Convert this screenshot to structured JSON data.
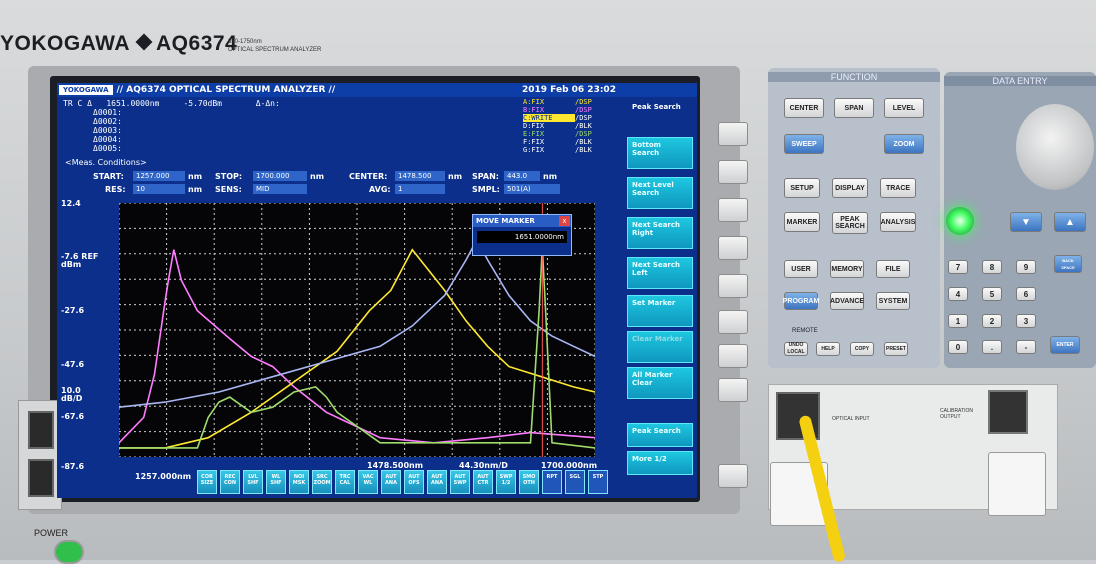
{
  "device": {
    "brand": "YOKOGAWA",
    "model": "AQ6374",
    "range": "350-1750nm",
    "product": "OPTICAL SPECTRUM ANALYZER",
    "power_label": "POWER"
  },
  "screen": {
    "logo": "YOKOGAWA",
    "title": "// AQ6374 OPTICAL SPECTRUM ANALYZER //",
    "datetime": "2019 Feb 06 23:02",
    "marker": {
      "trace_label": "TR C Δ",
      "wavelength": "1651.0000nm",
      "level": "-5.70dBm",
      "delta_label": "Δ-Δn:",
      "deltas": [
        "Δ0001:",
        "Δ0002:",
        "Δ0003:",
        "Δ0004:",
        "Δ0005:"
      ]
    },
    "traces": [
      {
        "name": "A:FIX",
        "mode": "/DSP",
        "color": "#ffe830"
      },
      {
        "name": "B:FIX",
        "mode": "/DSP",
        "color": "#ff7cff"
      },
      {
        "name": "C:WRITE",
        "mode": "/DSP",
        "color": "#ffffff"
      },
      {
        "name": "D:FIX",
        "mode": "/BLK",
        "color": "#ffffff"
      },
      {
        "name": "E:FIX",
        "mode": "/DSP",
        "color": "#9fdc6b"
      },
      {
        "name": "F:FIX",
        "mode": "/BLK",
        "color": "#ffffff"
      },
      {
        "name": "G:FIX",
        "mode": "/BLK",
        "color": "#ffffff"
      }
    ],
    "meas": {
      "title": "<Meas. Conditions>",
      "start_label": "START:",
      "start": "1257.000",
      "start_unit": "nm",
      "stop_label": "STOP:",
      "stop": "1700.000",
      "stop_unit": "nm",
      "center_label": "CENTER:",
      "center": "1478.500",
      "center_unit": "nm",
      "span_label": "SPAN:",
      "span": "443.0",
      "span_unit": "nm",
      "res_label": "RES:",
      "res": "10",
      "res_unit": "nm",
      "sens_label": "SENS:",
      "sens": "MID",
      "avg_label": "AVG:",
      "avg": "1",
      "smpl_label": "SMPL:",
      "smpl": "501(A)"
    },
    "y_labels": [
      "12.4",
      "-7.6",
      "dBm",
      "REF",
      "-27.6",
      "-47.6",
      "10.0",
      "dB/D",
      "-67.6",
      "-87.6"
    ],
    "x_labels": {
      "start": "1257.000nm",
      "center": "1478.500nm",
      "per_div": "44.30nm/D",
      "stop": "1700.000nm"
    },
    "move_marker": {
      "title": "MOVE MARKER",
      "close": "x",
      "value": "1651.0000nm"
    },
    "side_menu": [
      "Peak Search",
      "Bottom Search",
      "Next Level Search",
      "Next Search Right",
      "Next Search Left",
      "Set Marker",
      "Clear Marker",
      "All Marker Clear",
      "Peak Search",
      "More 1/2"
    ],
    "bottom_keys": [
      "COR SIZE",
      "REC CON",
      "LVL SHF",
      "WL SHF",
      "NOI MSK",
      "SRC ZOOM",
      "TRC CAL",
      "VAC WL",
      "AUT ANA",
      "AUT OFS",
      "AUT ANA",
      "AUT SWP",
      "AUT CTR",
      "SWP 1/2",
      "SMO OTH",
      "RPT",
      "SGL",
      "STP"
    ]
  },
  "function_panel": {
    "title": "FUNCTION",
    "keys": [
      "CENTER",
      "SPAN",
      "LEVEL",
      "SWEEP",
      "ZOOM",
      "SETUP",
      "DISPLAY",
      "TRACE",
      "MARKER",
      "PEAK SEARCH",
      "ANALYSIS",
      "USER",
      "MEMORY",
      "FILE",
      "PROGRAM",
      "ADVANCE",
      "SYSTEM",
      "REMOTE",
      "UNDO LOCAL",
      "HELP",
      "COPY",
      "PRESET"
    ]
  },
  "data_entry": {
    "title": "DATA ENTRY",
    "keys": [
      "7",
      "8",
      "9",
      "BACK SPACE",
      "4",
      "5",
      "6",
      "1",
      "2",
      "3",
      "0",
      ".",
      "-",
      "ENTER"
    ]
  },
  "io": {
    "optical_input": "OPTICAL INPUT",
    "calibration_output": "CALIBRATION OUTPUT"
  },
  "chart_data": {
    "type": "line",
    "xlim": [
      1257.0,
      1700.0
    ],
    "ylim": [
      -87.6,
      12.4
    ],
    "xlabel": "",
    "ylabel": "",
    "grid": true,
    "series": [
      {
        "name": "B:FIX",
        "color": "#ff7cff",
        "x": [
          1257,
          1280,
          1290,
          1300,
          1303,
          1308,
          1315,
          1330,
          1360,
          1380,
          1400,
          1420,
          1450,
          1480,
          1500,
          1550,
          1600,
          1640,
          1700
        ],
        "y": [
          -82,
          -72,
          -55,
          -26,
          -18,
          -6,
          -18,
          -30,
          -41,
          -48,
          -52,
          -60,
          -70,
          -76,
          -80,
          -82,
          -80,
          -78,
          -80
        ]
      },
      {
        "name": "A:FIX",
        "color": "#ffe830",
        "x": [
          1257,
          1300,
          1340,
          1380,
          1420,
          1460,
          1490,
          1510,
          1530,
          1560,
          1580,
          1600,
          1620,
          1650,
          1680,
          1700
        ],
        "y": [
          -84,
          -84,
          -80,
          -70,
          -58,
          -46,
          -30,
          -22,
          -6,
          -22,
          -34,
          -44,
          -52,
          -56,
          -60,
          -62
        ]
      },
      {
        "name": "C:WRITE",
        "color": "#a9b8f5",
        "x": [
          1257,
          1300,
          1350,
          1400,
          1450,
          1500,
          1530,
          1560,
          1580,
          1590,
          1600,
          1620,
          1640,
          1660,
          1680,
          1700
        ],
        "y": [
          -68,
          -66,
          -62,
          -56,
          -50,
          -44,
          -36,
          -24,
          -10,
          -2,
          -10,
          -24,
          -34,
          -40,
          -44,
          -48
        ]
      },
      {
        "name": "E:FIX",
        "color": "#9fdc6b",
        "x": [
          1257,
          1330,
          1340,
          1350,
          1360,
          1380,
          1400,
          1420,
          1440,
          1450,
          1460,
          1480,
          1500,
          1560,
          1600,
          1640,
          1648,
          1651,
          1654,
          1660,
          1700
        ],
        "y": [
          -84,
          -84,
          -72,
          -66,
          -64,
          -70,
          -68,
          -62,
          -60,
          -64,
          -70,
          -76,
          -82,
          -82,
          -82,
          -82,
          -30,
          -5,
          -30,
          -82,
          -84
        ]
      }
    ]
  }
}
